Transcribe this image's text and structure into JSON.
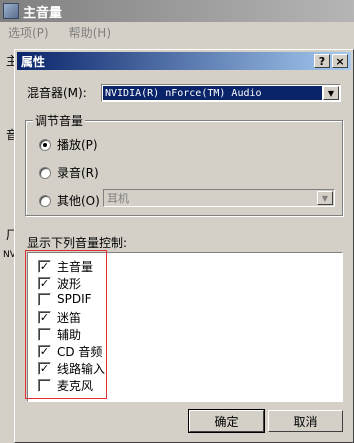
{
  "parent_window": {
    "title": "主音量",
    "menu": [
      "选项(P)",
      "帮助(H)"
    ],
    "ghost_labels": {
      "label_a": "主",
      "label_b": "音",
      "label_c": "厂",
      "label_d": "NV"
    }
  },
  "dialog": {
    "title": "属性",
    "help_button": "?",
    "close_button": "×",
    "mixer_label": "混音器(M):",
    "mixer_value": "NVIDIA(R) nForce(TM) Audio",
    "adjust_group": {
      "legend": "调节音量",
      "options": [
        {
          "label": "播放(P)",
          "selected": true
        },
        {
          "label": "录音(R)",
          "selected": false
        },
        {
          "label": "其他(O)",
          "selected": false
        }
      ],
      "other_device": "耳机"
    },
    "controls_label": "显示下列音量控制:",
    "controls": [
      {
        "label": "主音量",
        "checked": true
      },
      {
        "label": "波形",
        "checked": true
      },
      {
        "label": "SPDIF",
        "checked": false
      },
      {
        "label": "迷笛",
        "checked": true
      },
      {
        "label": "辅助",
        "checked": false
      },
      {
        "label": "CD 音频",
        "checked": true
      },
      {
        "label": "线路输入",
        "checked": true
      },
      {
        "label": "麦克风",
        "checked": false
      }
    ],
    "ok_button": "确定",
    "cancel_button": "取消",
    "check_mark": "✓",
    "highlight_color": "#e03030"
  }
}
